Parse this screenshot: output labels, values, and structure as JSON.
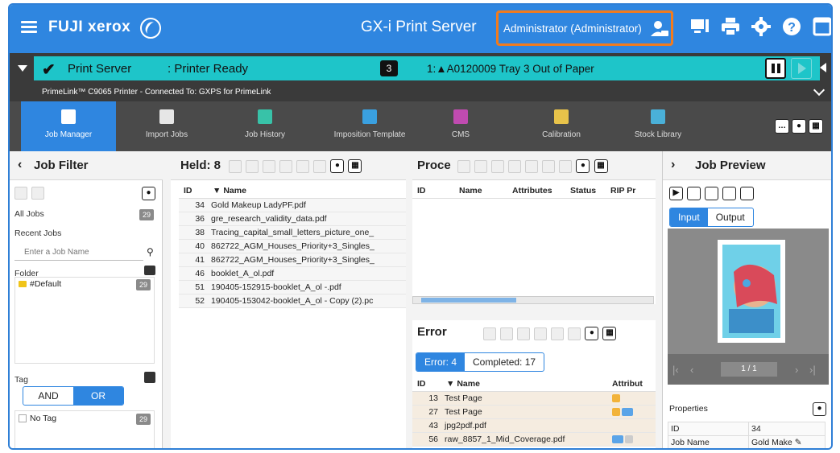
{
  "header": {
    "brand": "FUJI xerox",
    "title": "GX-i Print Server",
    "user": "Administrator (Administrator)",
    "icons": [
      "monitor-icon",
      "printer-icon",
      "gear-icon",
      "help-icon",
      "window-icon"
    ]
  },
  "status": {
    "server_label": "Print Server",
    "state": ": Printer Ready",
    "queue_count": "3",
    "alert": "1:▲A0120009 Tray 3 Out of Paper"
  },
  "printer_info": "PrimeLink™ C9065 Printer - Connected To: GXPS for PrimeLink",
  "nav": {
    "tabs": [
      {
        "label": "Job Manager",
        "color": "#e6e6e6"
      },
      {
        "label": "Import Jobs",
        "color": "#e6e6e6"
      },
      {
        "label": "Job History",
        "color": "#38c2a8"
      },
      {
        "label": "Imposition Template",
        "color": "#3aa0e0"
      },
      {
        "label": "CMS",
        "color": "#c04bb0"
      },
      {
        "label": "Calibration",
        "color": "#e8c34a"
      },
      {
        "label": "Stock Library",
        "color": "#4ab0d8"
      }
    ]
  },
  "job_filter": {
    "title": "Job Filter",
    "all_jobs": "All Jobs",
    "all_jobs_count": "29",
    "recent_jobs": "Recent Jobs",
    "search_placeholder": "Enter a Job Name",
    "folder": "Folder",
    "default_folder": "#Default",
    "default_count": "29",
    "tag": "Tag",
    "and": "AND",
    "or": "OR",
    "no_tag": "No Tag",
    "no_tag_count": "29"
  },
  "held": {
    "title": "Held: 8",
    "col_id": "ID",
    "col_name": "Name",
    "rows": [
      {
        "id": "34",
        "name": "Gold Makeup LadyPF.pdf"
      },
      {
        "id": "36",
        "name": "gre_research_validity_data.pdf"
      },
      {
        "id": "38",
        "name": "Tracing_capital_small_letters_picture_one_"
      },
      {
        "id": "40",
        "name": "862722_AGM_Houses_Priority+3_Singles_"
      },
      {
        "id": "41",
        "name": "862722_AGM_Houses_Priority+3_Singles_"
      },
      {
        "id": "46",
        "name": "booklet_A_ol.pdf"
      },
      {
        "id": "51",
        "name": "190405-152915-booklet_A_ol -.pdf"
      },
      {
        "id": "52",
        "name": "190405-153042-booklet_A_ol - Copy (2).pc"
      }
    ]
  },
  "processing": {
    "title": "Proce",
    "cols": [
      "ID",
      "Name",
      "Attributes",
      "Status",
      "RIP Pr"
    ]
  },
  "error": {
    "title": "Error",
    "tab_error": "Error: 4",
    "tab_completed": "Completed: 17",
    "col_id": "ID",
    "col_name": "Name",
    "col_attr": "Attribut",
    "rows": [
      {
        "id": "13",
        "name": "Test Page"
      },
      {
        "id": "27",
        "name": "Test Page"
      },
      {
        "id": "43",
        "name": "jpg2pdf.pdf"
      },
      {
        "id": "56",
        "name": "raw_8857_1_Mid_Coverage.pdf"
      }
    ]
  },
  "preview": {
    "title": "Job Preview",
    "tab_input": "Input",
    "tab_output": "Output",
    "page": "1 / 1",
    "properties": "Properties",
    "prop_rows": [
      {
        "key": "ID",
        "value": "34"
      },
      {
        "key": "Job Name",
        "value": "Gold Make"
      }
    ]
  }
}
